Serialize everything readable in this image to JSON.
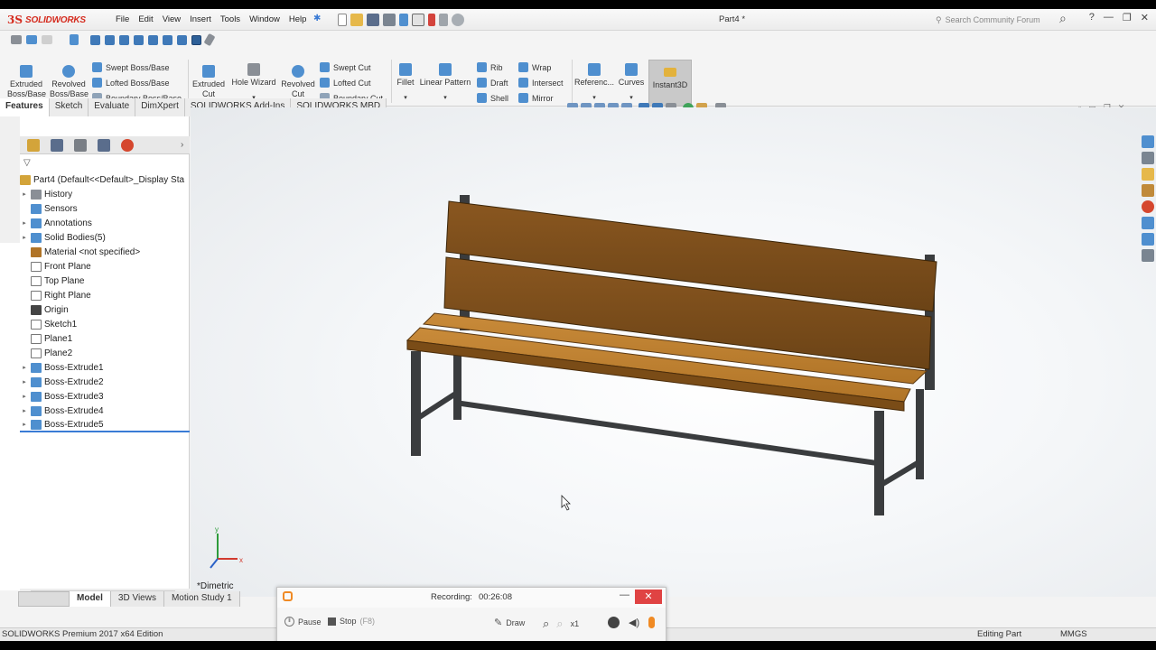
{
  "app": {
    "brand": "SOLIDWORKS",
    "document_title": "Part4 *",
    "search_placeholder": "Search Community Forum",
    "menus": [
      "File",
      "Edit",
      "View",
      "Insert",
      "Tools",
      "Window",
      "Help"
    ]
  },
  "commands": {
    "extruded_boss": "Extruded Boss/Base",
    "revolved_boss": "Revolved Boss/Base",
    "swept_boss": "Swept Boss/Base",
    "lofted_boss": "Lofted Boss/Base",
    "boundary_boss": "Boundary Boss/Base",
    "extruded_cut": "Extruded Cut",
    "hole_wizard": "Hole Wizard",
    "revolved_cut": "Revolved Cut",
    "swept_cut": "Swept Cut",
    "lofted_cut": "Lofted Cut",
    "boundary_cut": "Boundary Cut",
    "fillet": "Fillet",
    "linear_pattern": "Linear Pattern",
    "rib": "Rib",
    "draft": "Draft",
    "shell": "Shell",
    "wrap": "Wrap",
    "intersect": "Intersect",
    "mirror": "Mirror",
    "reference": "Referenc...",
    "curves": "Curves",
    "instant3d": "Instant3D"
  },
  "tabs": [
    "Features",
    "Sketch",
    "Evaluate",
    "DimXpert",
    "SOLIDWORKS Add-Ins",
    "SOLIDWORKS MBD"
  ],
  "tree": {
    "root": "Part4  (Default<<Default>_Display Sta",
    "items": [
      {
        "label": "History",
        "expand": "▸"
      },
      {
        "label": "Sensors",
        "expand": ""
      },
      {
        "label": "Annotations",
        "expand": "▸"
      },
      {
        "label": "Solid Bodies(5)",
        "expand": "▸"
      },
      {
        "label": "Material <not specified>",
        "expand": ""
      },
      {
        "label": "Front Plane",
        "expand": ""
      },
      {
        "label": "Top Plane",
        "expand": ""
      },
      {
        "label": "Right Plane",
        "expand": ""
      },
      {
        "label": "Origin",
        "expand": ""
      },
      {
        "label": "Sketch1",
        "expand": ""
      },
      {
        "label": "Plane1",
        "expand": ""
      },
      {
        "label": "Plane2",
        "expand": ""
      },
      {
        "label": "Boss-Extrude1",
        "expand": "▸"
      },
      {
        "label": "Boss-Extrude2",
        "expand": "▸"
      },
      {
        "label": "Boss-Extrude3",
        "expand": "▸"
      },
      {
        "label": "Boss-Extrude4",
        "expand": "▸"
      },
      {
        "label": "Boss-Extrude5",
        "expand": "▸"
      }
    ]
  },
  "viewport": {
    "view_name": "*Dimetric"
  },
  "bottom_tabs": [
    "Model",
    "3D Views",
    "Motion Study 1"
  ],
  "status": {
    "edition": "SOLIDWORKS Premium 2017 x64 Edition",
    "mode": "Editing Part",
    "units": "MMGS"
  },
  "recorder": {
    "label": "Recording:",
    "time": "00:26:08",
    "pause": "Pause",
    "stop": "Stop",
    "stop_key": "(F8)",
    "draw": "Draw",
    "zoom": "x1"
  },
  "colors": {
    "brand_red": "#d52b1e",
    "wood": "#b77a2e",
    "wood_dark": "#6b4316",
    "frame": "#3a3c3e"
  }
}
